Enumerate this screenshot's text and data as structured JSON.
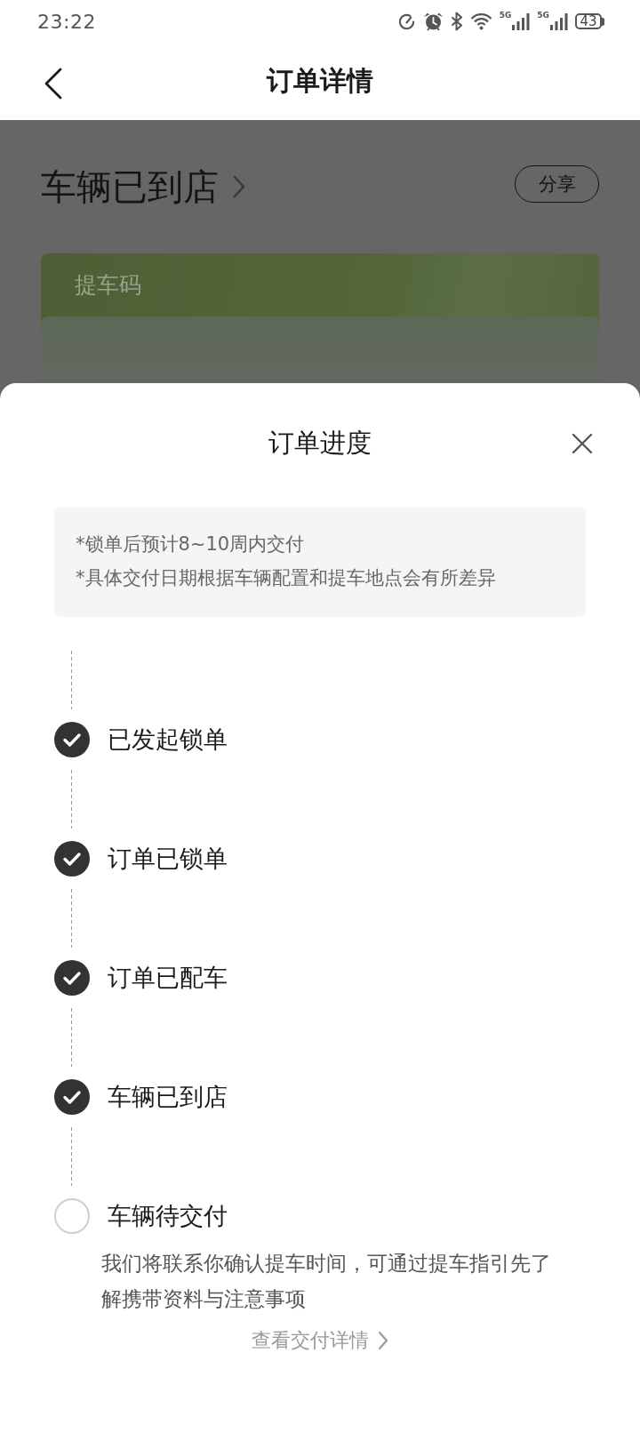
{
  "status_bar": {
    "time": "23:22",
    "signals": [
      {
        "network": "5G"
      },
      {
        "network": "5G"
      }
    ],
    "battery": "43"
  },
  "nav": {
    "title": "订单详情"
  },
  "order": {
    "status": "车辆已到店",
    "share_button": "分享",
    "code_card": {
      "title": "提车码"
    }
  },
  "sheet": {
    "title": "订单进度",
    "notes": [
      "*锁单后预计8~10周内交付",
      "*具体交付日期根据车辆配置和提车地点会有所差异"
    ],
    "steps": [
      {
        "label": "已发起锁单",
        "done": true
      },
      {
        "label": "订单已锁单",
        "done": true
      },
      {
        "label": "订单已配车",
        "done": true
      },
      {
        "label": "车辆已到店",
        "done": true
      },
      {
        "label": "车辆待交付",
        "done": false,
        "description": "我们将联系你确认提车时间，可通过提车指引先了解携带资料与注意事项"
      }
    ],
    "link": "查看交付详情"
  }
}
